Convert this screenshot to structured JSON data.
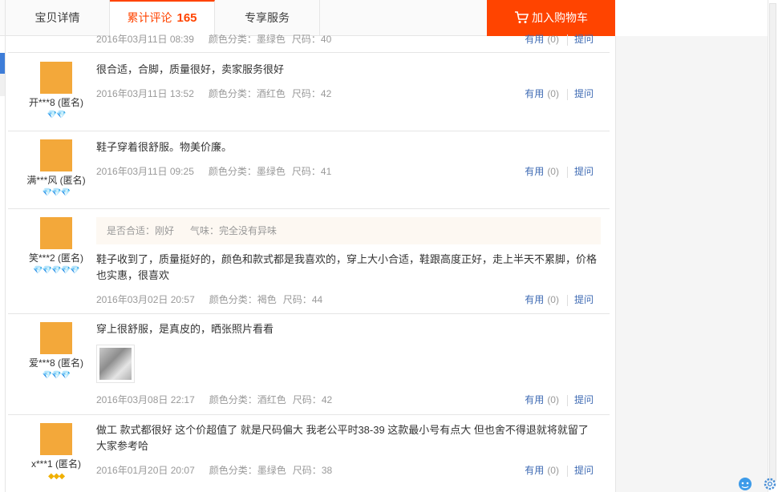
{
  "tabs": {
    "details": "宝贝详情",
    "reviews_label": "累计评论",
    "reviews_count": "165",
    "service": "专享服务",
    "cart_label": "加入购物车"
  },
  "labels": {
    "sku_prefix": "颜色分类：",
    "size_prefix": "尺码：",
    "useful": "有用",
    "ask": "提问"
  },
  "reviews": [
    {
      "user": "",
      "content": "",
      "date": "2016年03月11日 08:39",
      "sku": "墨绿色",
      "size": "40",
      "useful_count": "(0)"
    },
    {
      "user": "开***8 (匿名)",
      "rank": "💎💎",
      "content": "很合适，合脚，质量很好，卖家服务很好",
      "date": "2016年03月11日 13:52",
      "sku": "酒红色",
      "size": "42",
      "useful_count": "(0)"
    },
    {
      "user": "满***风 (匿名)",
      "rank": "💎💎💎",
      "content": "鞋子穿着很舒服。物美价廉。",
      "date": "2016年03月11日 09:25",
      "sku": "墨绿色",
      "size": "41",
      "useful_count": "(0)"
    },
    {
      "user": "笑***2 (匿名)",
      "rank": "💎💎💎💎💎",
      "tags": [
        "是否合适：刚好",
        "气味：完全没有异味"
      ],
      "content": "鞋子收到了，质量挺好的，颜色和款式都是我喜欢的，穿上大小合适，鞋跟高度正好，走上半天不累脚，价格也实惠，很喜欢",
      "date": "2016年03月02日 20:57",
      "sku": "褐色",
      "size": "44",
      "useful_count": "(0)"
    },
    {
      "user": "爱***8 (匿名)",
      "rank": "💎💎💎",
      "content": "穿上很舒服，是真皮的，晒张照片看看",
      "date": "2016年03月08日 22:17",
      "sku": "酒红色",
      "size": "42",
      "useful_count": "(0)"
    },
    {
      "user": "x***1 (匿名)",
      "rank": "◆◆◆",
      "content": "做工 款式都很好 这个价超值了 就是尺码偏大 我老公平时38-39 这款最小号有点大 但也舍不得退就将就留了 大家参考哈",
      "date": "2016年01月20日 20:07",
      "sku": "墨绿色",
      "size": "38",
      "useful_count": "(0)"
    }
  ]
}
